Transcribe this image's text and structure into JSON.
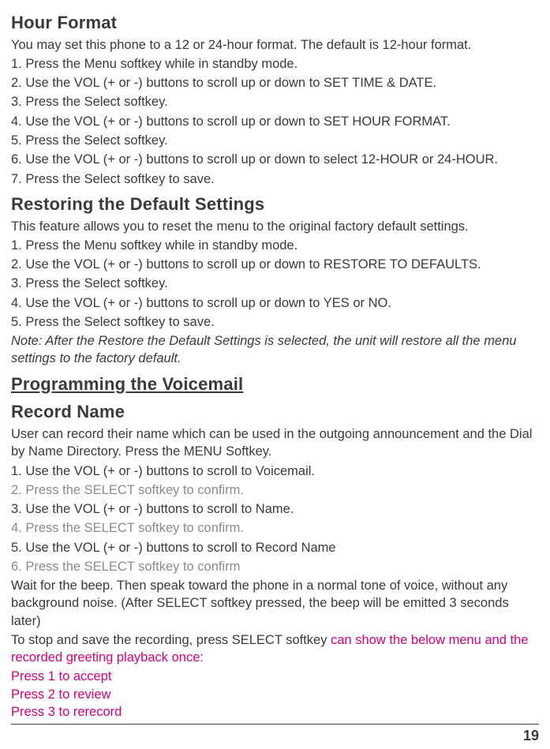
{
  "hour_format": {
    "title": "Hour Format",
    "intro": "You may set this phone to a 12 or 24-hour format. The default is 12-hour format.",
    "steps": [
      "1. Press the Menu softkey while in standby mode.",
      "2. Use the VOL (+ or -) buttons to scroll up or down to SET TIME & DATE.",
      "3. Press the Select softkey.",
      "4. Use the VOL (+ or -) buttons to scroll up or down to SET HOUR FORMAT.",
      "5. Press the Select softkey.",
      "6. Use the VOL (+ or -) buttons to scroll up or down to select 12-HOUR or 24-HOUR.",
      "7. Press the Select softkey to save."
    ]
  },
  "restore": {
    "title": "Restoring the Default Settings",
    "intro": "This feature allows you to reset the menu to the original factory default settings.",
    "steps": [
      "1. Press the Menu softkey while in standby mode.",
      "2. Use the VOL (+ or -) buttons to scroll up or down to RESTORE TO DEFAULTS.",
      "3. Press the Select softkey.",
      "4. Use the VOL (+ or -) buttons to scroll up or down to YES or NO.",
      "5. Press the Select softkey to save."
    ],
    "note": "Note: After the Restore the Default Settings is selected, the unit will restore all the menu settings to the factory default."
  },
  "voicemail": {
    "title": "Programming the Voicemail"
  },
  "record_name": {
    "title": "Record Name",
    "intro": "User can record their name which can be used in the outgoing announcement and the Dial by Name Directory. Press the MENU Softkey.",
    "steps": [
      {
        "text": "1. Use the VOL (+ or -) buttons to scroll to Voicemail.",
        "faded": false
      },
      {
        "text": "2. Press the SELECT softkey to confirm.",
        "faded": true
      },
      {
        "text": "3. Use the VOL (+ or -) buttons to scroll to Name.",
        "faded": false
      },
      {
        "text": "4. Press the SELECT softkey to confirm.",
        "faded": true
      },
      {
        "text": "5. Use the VOL (+ or -) buttons to scroll to Record Name",
        "faded": false
      },
      {
        "text": "6. Press the SELECT softkey to confirm",
        "faded": true
      }
    ],
    "wait": "Wait for the beep. Then speak toward the phone in a normal tone of voice, without any background noise. (After SELECT softkey pressed, the beep will be emitted 3 seconds later)",
    "stop_prefix": "To stop and save the recording, press SELECT softkey ",
    "stop_magenta": "can show the below menu and the recorded greeting playback once:",
    "magenta_lines": [
      "Press 1 to accept",
      "Press 2 to review",
      "Press 3 to rerecord"
    ]
  },
  "page_number": "19"
}
